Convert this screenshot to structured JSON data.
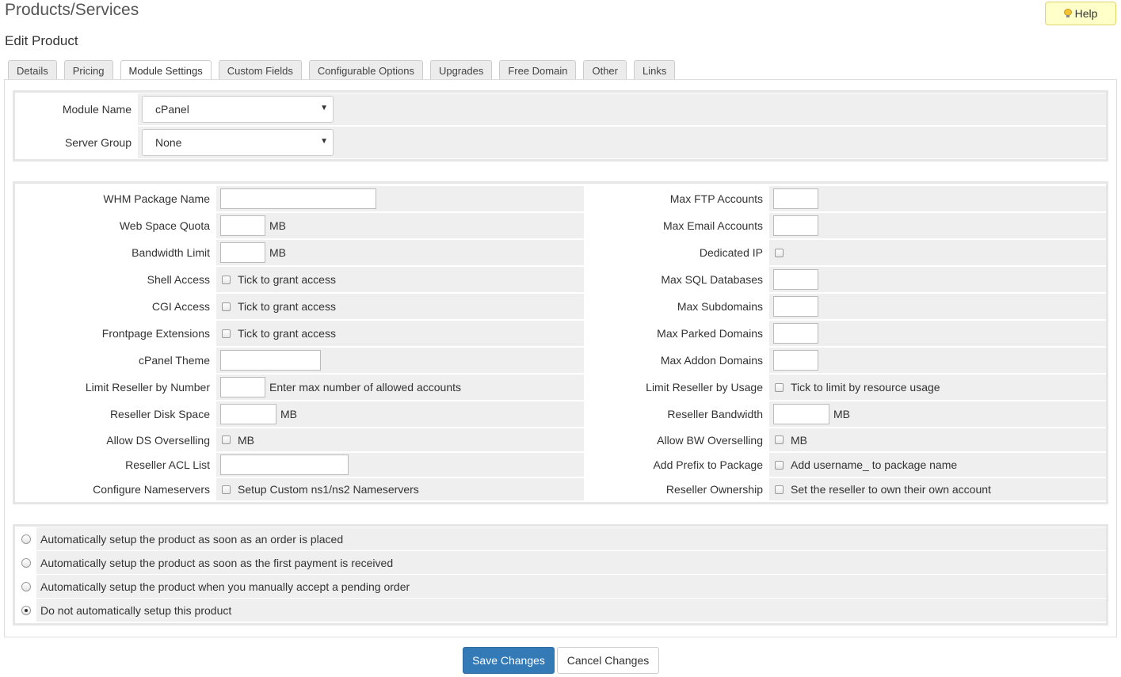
{
  "page": {
    "title": "Products/Services",
    "subtitle": "Edit Product",
    "help_label": "Help"
  },
  "tabs": [
    {
      "label": "Details"
    },
    {
      "label": "Pricing"
    },
    {
      "label": "Module Settings",
      "active": true
    },
    {
      "label": "Custom Fields"
    },
    {
      "label": "Configurable Options"
    },
    {
      "label": "Upgrades"
    },
    {
      "label": "Free Domain"
    },
    {
      "label": "Other"
    },
    {
      "label": "Links"
    }
  ],
  "module": {
    "module_name_label": "Module Name",
    "module_name_value": "cPanel",
    "server_group_label": "Server Group",
    "server_group_value": "None"
  },
  "settings": {
    "left": {
      "whm_package_name": "WHM Package Name",
      "web_space_quota": "Web Space Quota",
      "bandwidth_limit": "Bandwidth Limit",
      "shell_access": "Shell Access",
      "cgi_access": "CGI Access",
      "frontpage_extensions": "Frontpage Extensions",
      "cpanel_theme": "cPanel Theme",
      "limit_reseller_by_number": "Limit Reseller by Number",
      "reseller_disk_space": "Reseller Disk Space",
      "allow_ds_overselling": "Allow DS Overselling",
      "reseller_acl_list": "Reseller ACL List",
      "configure_nameservers": "Configure Nameservers"
    },
    "right": {
      "max_ftp_accounts": "Max FTP Accounts",
      "max_email_accounts": "Max Email Accounts",
      "dedicated_ip": "Dedicated IP",
      "max_sql_databases": "Max SQL Databases",
      "max_subdomains": "Max Subdomains",
      "max_parked_domains": "Max Parked Domains",
      "max_addon_domains": "Max Addon Domains",
      "limit_reseller_by_usage": "Limit Reseller by Usage",
      "reseller_bandwidth": "Reseller Bandwidth",
      "allow_bw_overselling": "Allow BW Overselling",
      "add_prefix_to_package": "Add Prefix to Package",
      "reseller_ownership": "Reseller Ownership"
    },
    "units": {
      "mb": "MB"
    },
    "hints": {
      "tick_grant": "Tick to grant access",
      "max_allowed_accounts": "Enter max number of allowed accounts",
      "tick_limit_usage": "Tick to limit by resource usage",
      "setup_ns": "Setup Custom ns1/ns2 Nameservers",
      "add_username_prefix": "Add username_ to package name",
      "reseller_own_account": "Set the reseller to own their own account"
    }
  },
  "autosetup": [
    {
      "label": "Automatically setup the product as soon as an order is placed",
      "selected": false
    },
    {
      "label": "Automatically setup the product as soon as the first payment is received",
      "selected": false
    },
    {
      "label": "Automatically setup the product when you manually accept a pending order",
      "selected": false
    },
    {
      "label": "Do not automatically setup this product",
      "selected": true
    }
  ],
  "actions": {
    "save_label": "Save Changes",
    "cancel_label": "Cancel Changes"
  },
  "colors": {
    "primary": "#337ab7",
    "help_bg": "#ffffc9",
    "field_bg": "#efefef"
  }
}
